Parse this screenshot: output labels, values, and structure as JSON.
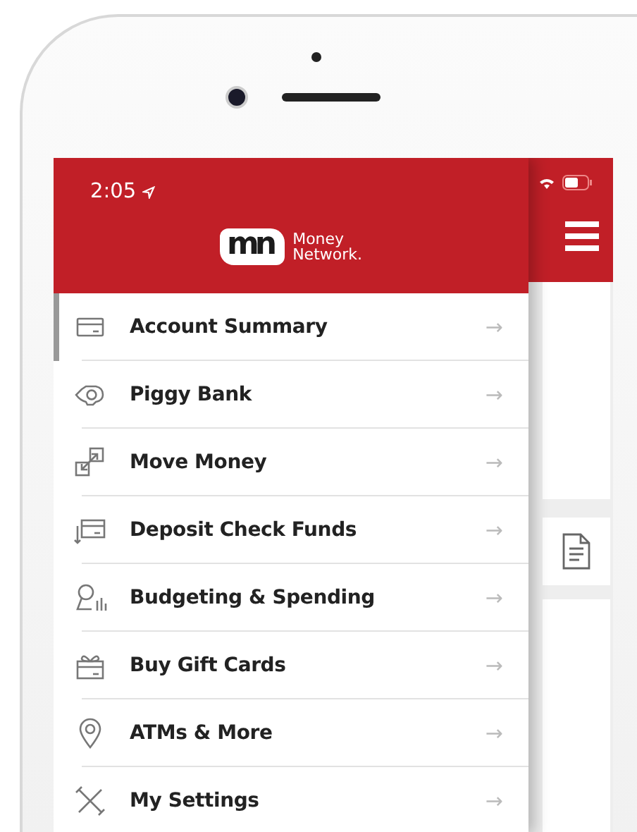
{
  "status_bar": {
    "time": "2:05"
  },
  "logo": {
    "mark": "mn",
    "line_1": "Money",
    "line_2": "Network."
  },
  "menu": [
    {
      "label": "Account Summary",
      "arrow": "→",
      "selected": true
    },
    {
      "label": "Piggy Bank",
      "arrow": "→",
      "selected": false
    },
    {
      "label": "Move Money",
      "arrow": "→",
      "selected": false
    },
    {
      "label": "Deposit Check Funds",
      "arrow": "→",
      "selected": false
    },
    {
      "label": "Budgeting & Spending",
      "arrow": "→",
      "selected": false
    },
    {
      "label": "Buy Gift Cards",
      "arrow": "→",
      "selected": false
    },
    {
      "label": "ATMs & More",
      "arrow": "→",
      "selected": false
    },
    {
      "label": "My Settings",
      "arrow": "→",
      "selected": false
    }
  ]
}
